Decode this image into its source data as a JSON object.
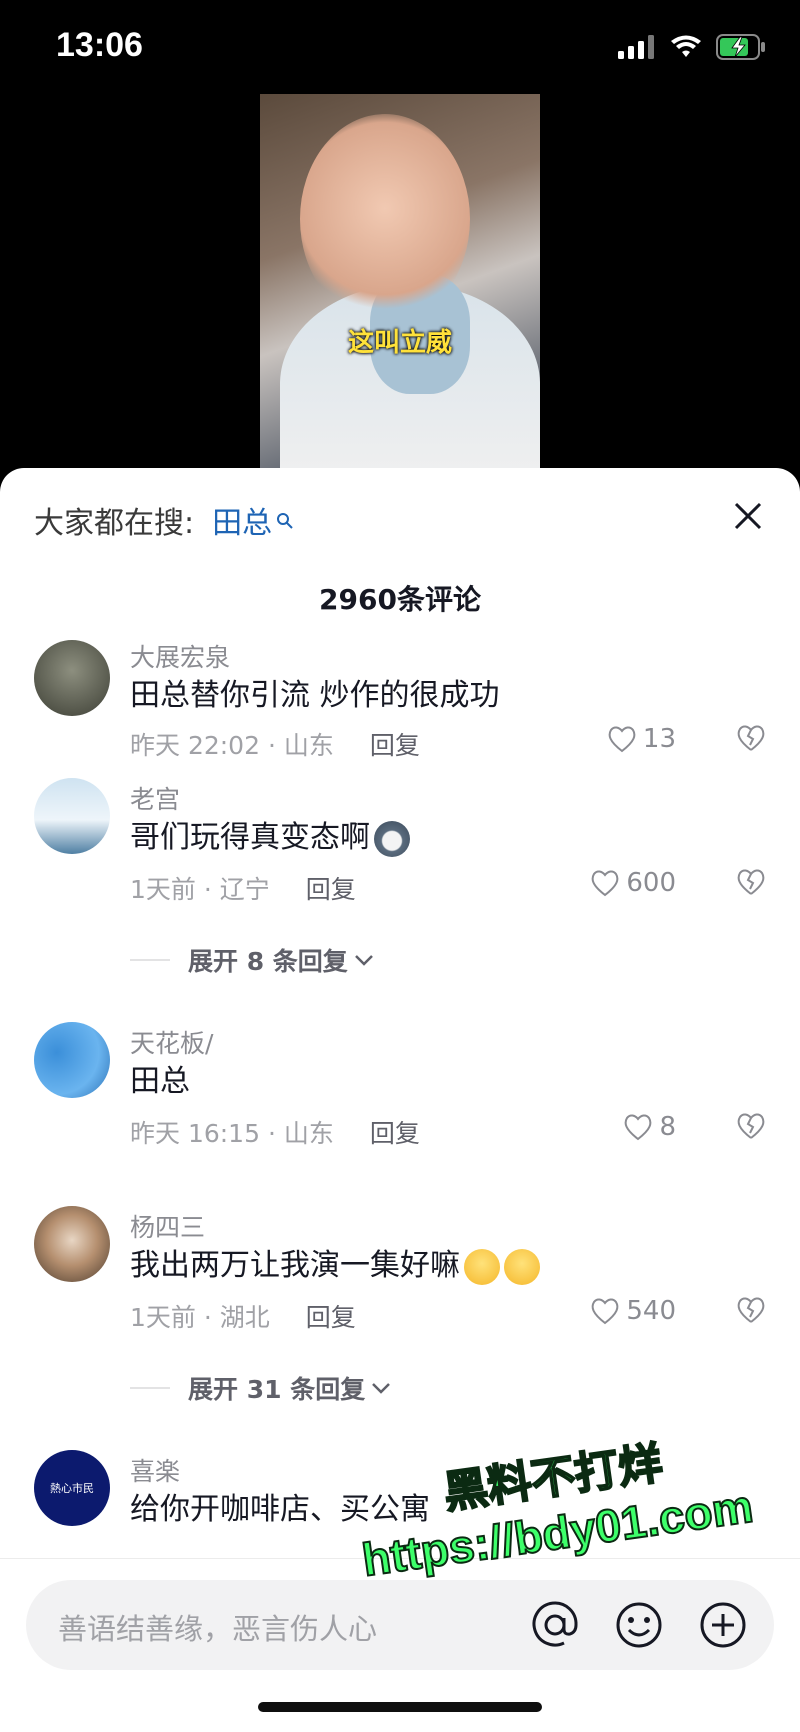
{
  "status": {
    "time": "13:06"
  },
  "video": {
    "caption": "这叫立威"
  },
  "search": {
    "prefix": "大家都在搜:",
    "term": "田总"
  },
  "header": {
    "count_label": "2960条评论"
  },
  "comments": [
    {
      "username": "大展宏泉",
      "text": "田总替你引流 炒作的很成功",
      "time_loc": "昨天 22:02 · 山东",
      "reply": "回复",
      "likes": "13"
    },
    {
      "username": "老宫",
      "text": "哥们玩得真变态啊",
      "time_loc": "1天前 · 辽宁",
      "reply": "回复",
      "likes": "600",
      "expand": "展开 8 条回复"
    },
    {
      "username": "天花板/",
      "text": "田总",
      "time_loc": "昨天 16:15 · 山东",
      "reply": "回复",
      "likes": "8"
    },
    {
      "username": "杨四三",
      "text": "我出两万让我演一集好嘛",
      "time_loc": "1天前 · 湖北",
      "reply": "回复",
      "likes": "540",
      "expand": "展开 31 条回复"
    },
    {
      "username": "喜楽",
      "text": "给你开咖啡店、买公寓",
      "avatar_text": "熱心市民"
    }
  ],
  "input": {
    "placeholder": "善语结善缘，恶言伤人心"
  },
  "watermark": {
    "line1": "黑料不打烊",
    "line2": "https://bdy01.com"
  },
  "colors": {
    "accent_blue": "#1e64b4",
    "caption_yellow": "#ffe13a",
    "watermark_green": "#3dff6a"
  }
}
